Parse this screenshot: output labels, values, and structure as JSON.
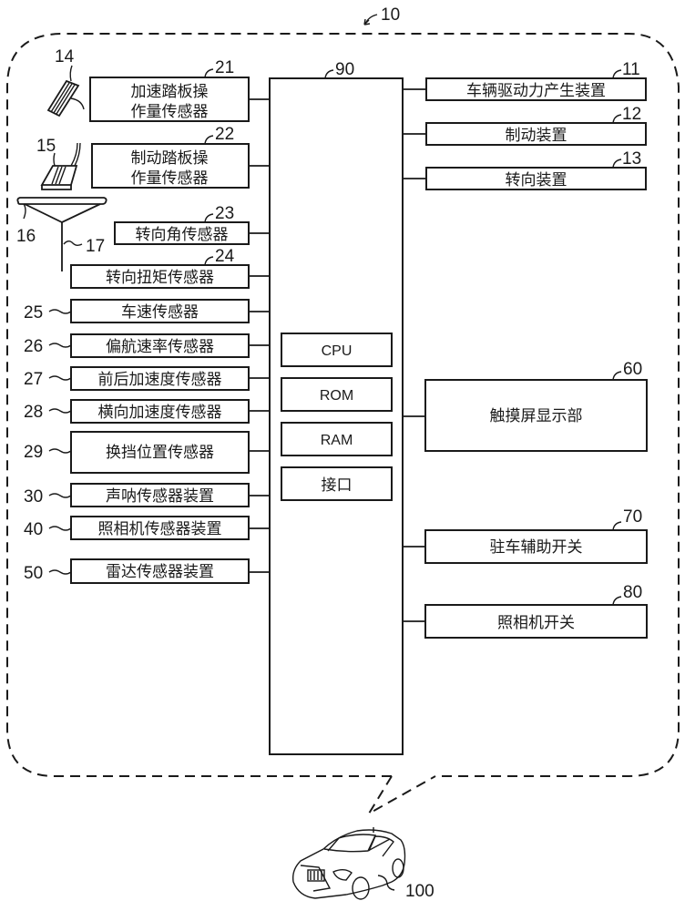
{
  "figure": {
    "system_ref": "10",
    "ecu": {
      "ref": "90",
      "components": [
        "CPU",
        "ROM",
        "RAM",
        "接口"
      ]
    },
    "inputs": [
      {
        "ref": "21",
        "label_lines": [
          "加速踏板操",
          "作量传感器"
        ]
      },
      {
        "ref": "22",
        "label_lines": [
          "制动踏板操",
          "作量传感器"
        ]
      },
      {
        "ref": "23",
        "label_lines": [
          "转向角传感器"
        ]
      },
      {
        "ref": "24",
        "label_lines": [
          "转向扭矩传感器"
        ]
      },
      {
        "ref": "25",
        "label_lines": [
          "车速传感器"
        ]
      },
      {
        "ref": "26",
        "label_lines": [
          "偏航速率传感器"
        ]
      },
      {
        "ref": "27",
        "label_lines": [
          "前后加速度传感器"
        ]
      },
      {
        "ref": "28",
        "label_lines": [
          "横向加速度传感器"
        ]
      },
      {
        "ref": "29",
        "label_lines": [
          "换挡位置传感器"
        ]
      },
      {
        "ref": "30",
        "label_lines": [
          "声呐传感器装置"
        ]
      },
      {
        "ref": "40",
        "label_lines": [
          "照相机传感器装置"
        ]
      },
      {
        "ref": "50",
        "label_lines": [
          "雷达传感器装置"
        ]
      }
    ],
    "outputs": [
      {
        "ref": "11",
        "label": "车辆驱动力产生装置"
      },
      {
        "ref": "12",
        "label": "制动装置"
      },
      {
        "ref": "13",
        "label": "转向装置"
      },
      {
        "ref": "60",
        "label": "触摸屏显示部"
      },
      {
        "ref": "70",
        "label": "驻车辅助开关"
      },
      {
        "ref": "80",
        "label": "照相机开关"
      }
    ],
    "components": [
      {
        "ref": "14",
        "name": "accelerator-pedal"
      },
      {
        "ref": "15",
        "name": "brake-pedal"
      },
      {
        "ref": "16",
        "name": "steering-wheel"
      },
      {
        "ref": "17",
        "name": "steering-shaft"
      }
    ],
    "vehicle_ref": "100"
  }
}
